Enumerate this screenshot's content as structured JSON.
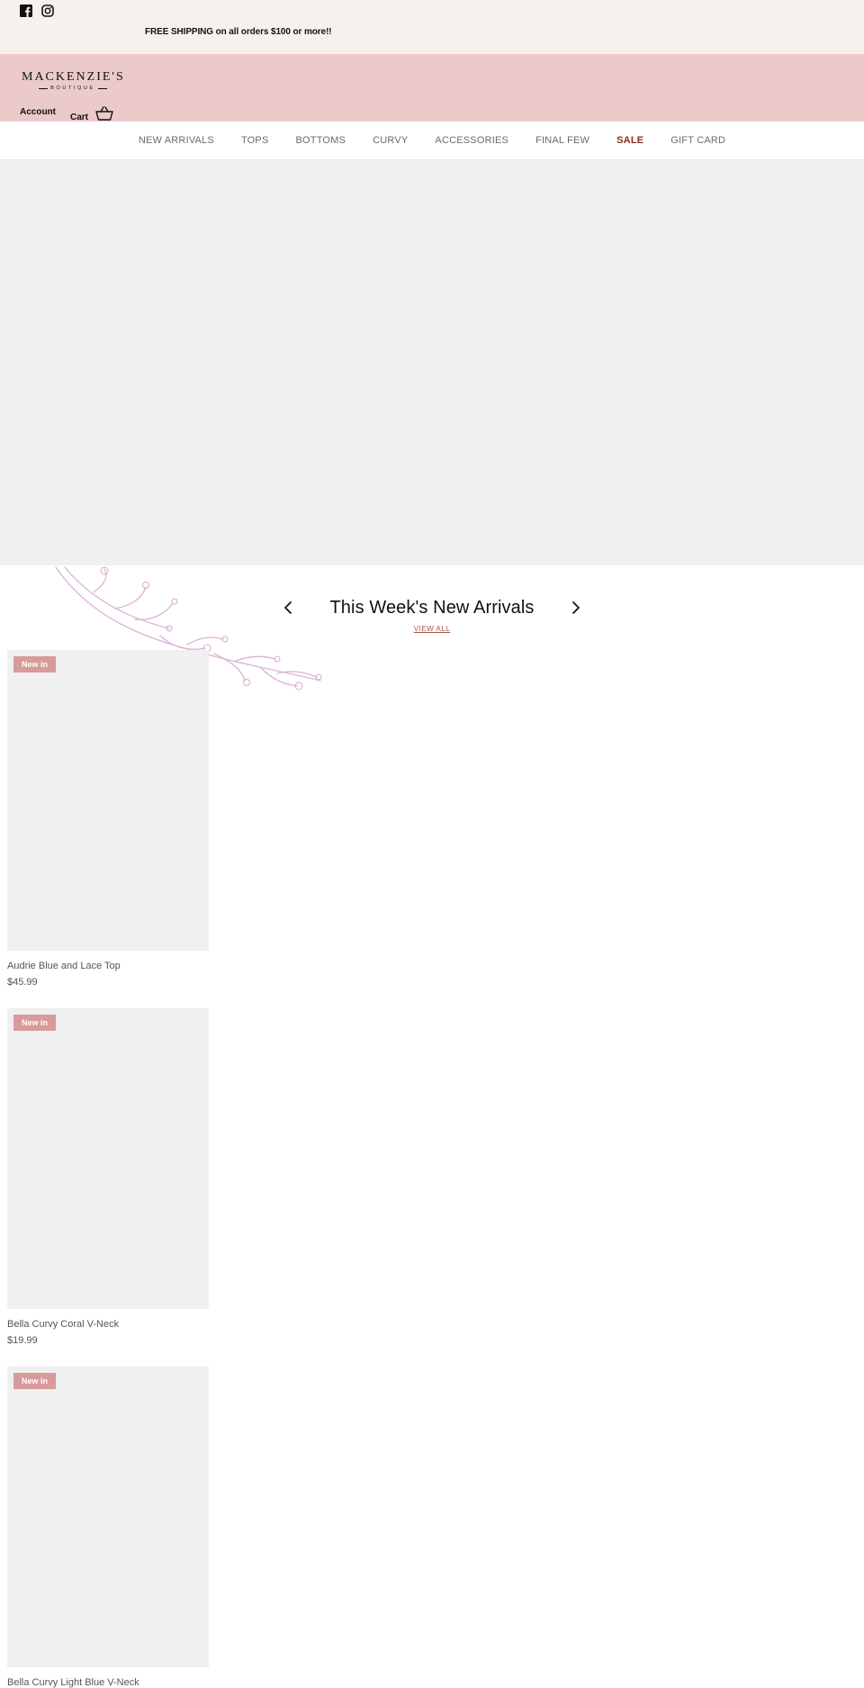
{
  "announcement": {
    "text": "FREE SHIPPING on all orders $100 or more!!"
  },
  "social": {
    "facebook_icon": "facebook-icon",
    "instagram_icon": "instagram-icon"
  },
  "header": {
    "logo_main": "MACKENZIE'S",
    "logo_sub": "BOUTIQUE",
    "account_label": "Account",
    "cart_label": "Cart",
    "cart_icon": "basket-icon"
  },
  "nav": {
    "items": [
      {
        "label": "NEW ARRIVALS"
      },
      {
        "label": "TOPS"
      },
      {
        "label": "BOTTOMS"
      },
      {
        "label": "CURVY"
      },
      {
        "label": "ACCESSORIES"
      },
      {
        "label": "FINAL FEW"
      },
      {
        "label": "SALE"
      },
      {
        "label": "GIFT CARD"
      }
    ]
  },
  "section": {
    "title": "This Week's New Arrivals",
    "view_all": "VIEW ALL"
  },
  "products": [
    {
      "badge": "New in",
      "title": "Audrie Blue and Lace Top",
      "price": "$45.99"
    },
    {
      "badge": "New in",
      "title": "Bella Curvy Coral V-Neck",
      "price": "$19.99"
    },
    {
      "badge": "New in",
      "title": "Bella Curvy Light Blue V-Neck",
      "price": ""
    }
  ],
  "colors": {
    "announce_bg": "#f7f1ee",
    "header_bg": "#eccaca",
    "badge_bg": "#d99a9a",
    "sale_color": "#8b2d1f",
    "link_color": "#a5574c"
  }
}
